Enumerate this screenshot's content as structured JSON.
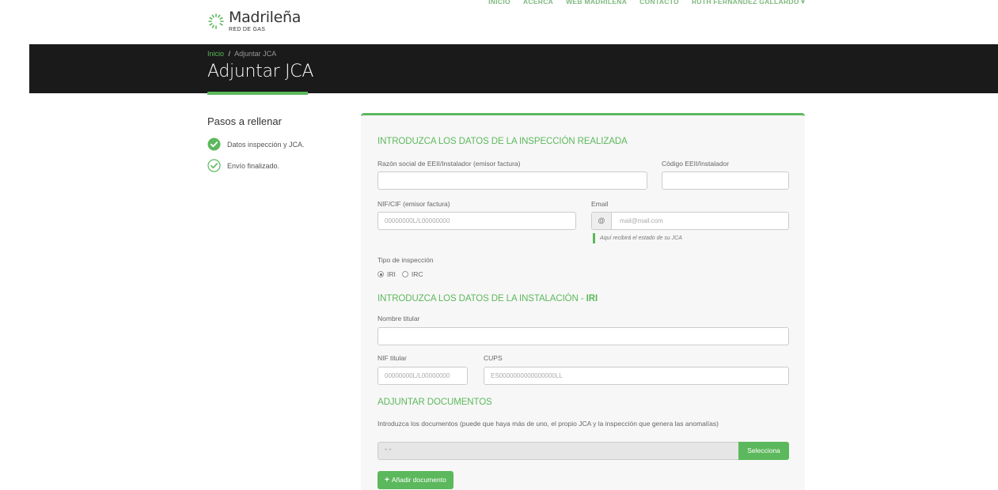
{
  "brand": {
    "name": "Madrileña",
    "sub": "RED DE GAS",
    "accent": "#5cb85c"
  },
  "nav": [
    "INICIO",
    "ACERCA",
    "WEB MADRILEÑA",
    "CONTACTO",
    "RUTH FERNANDEZ GALLARDO ▾"
  ],
  "breadcrumb": {
    "home": "Inicio",
    "separator": "/",
    "current": "Adjuntar JCA"
  },
  "page_title": "Adjuntar JCA",
  "steps": {
    "title": "Pasos a rellenar",
    "items": [
      {
        "label": "Datos inspección y JCA.",
        "icon": "check-circle-filled-icon"
      },
      {
        "label": "Envío finalizado.",
        "icon": "check-circle-outline-icon"
      }
    ]
  },
  "form": {
    "section1": "INTRODUZCA LOS DATOS DE LA INSPECCIÓN REALIZADA",
    "razon_label": "Razón social de EEII/Instalador (emisor factura)",
    "razon_value": "",
    "codigo_label": "Código EEII/Instalador",
    "codigo_value": "",
    "nif_label": "NIF/CIF (emisor factura)",
    "nif_placeholder": "00000000L/L00000000",
    "email_label": "Email",
    "email_addon": "@",
    "email_placeholder": "mail@mail.com",
    "email_hint": "Aquí recibirá el estado de su JCA",
    "tipo_label": "Tipo de inspección",
    "tipo_options": [
      "IRI",
      "IRC"
    ],
    "tipo_selected": "IRI",
    "section2_prefix": "INTRODUZCA LOS DATOS DE LA INSTALACIÓN - ",
    "section2_type": "IRI",
    "titular_label": "Nombre titular",
    "titular_value": "",
    "nif_titular_label": "NIF titular",
    "nif_titular_placeholder": "00000000L/L00000000",
    "cups_label": "CUPS",
    "cups_placeholder": "ES0000000000000000LL",
    "section3": "ADJUNTAR DOCUMENTOS",
    "docs_desc": "Introduzca los documentos (puede que haya más de uno, el propio JCA y la inspección que genera las anomalías)",
    "file_placeholder": "*.*",
    "select_button": "Selecciona",
    "add_button": "Añadir documento",
    "add_icon": "plus-icon"
  }
}
